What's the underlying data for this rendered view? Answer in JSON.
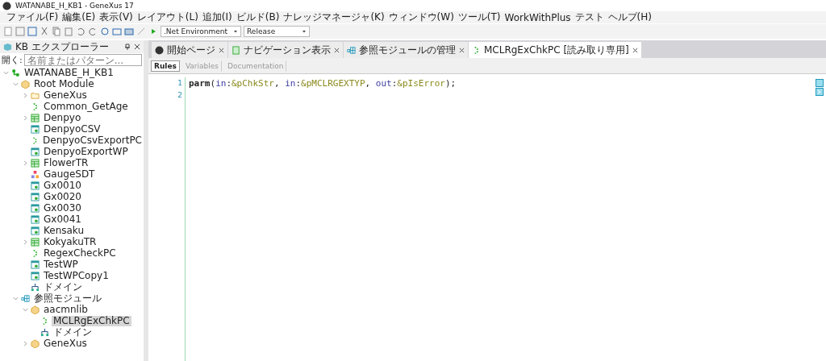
{
  "window": {
    "title": "WATANABE_H_KB1 - GeneXus 17"
  },
  "menu": [
    "ファイル(F)",
    "編集(E)",
    "表示(V)",
    "レイアウト(L)",
    "追加(I)",
    "ビルド(B)",
    "ナレッジマネージャ(K)",
    "ウィンドウ(W)",
    "ツール(T)",
    "WorkWithPlus",
    "テスト",
    "ヘルプ(H)"
  ],
  "toolbar": {
    "environment": ".Net Environment",
    "configuration": "Release"
  },
  "explorer": {
    "title": "KB エクスプローラー",
    "filter_label": "開く:",
    "filter_placeholder": "名前またはパターン...",
    "tree": [
      {
        "label": "WATANABE_H_KB1",
        "kind": "kb",
        "expanded": true,
        "selected": false,
        "children": [
          {
            "label": "Root Module",
            "kind": "module",
            "expanded": true,
            "selected": false,
            "children": [
              {
                "label": "GeneXus",
                "kind": "folder",
                "expanded": false,
                "selected": false
              },
              {
                "label": "Common_GetAge",
                "kind": "procedure",
                "selected": false
              },
              {
                "label": "Denpyo",
                "kind": "transaction",
                "expanded": false,
                "selected": false
              },
              {
                "label": "DenpyoCSV",
                "kind": "webpanel",
                "selected": false
              },
              {
                "label": "DenpyoCsvExportPC",
                "kind": "procedure",
                "selected": false
              },
              {
                "label": "DenpyoExportWP",
                "kind": "webpanel",
                "selected": false
              },
              {
                "label": "FlowerTR",
                "kind": "transaction",
                "expanded": false,
                "selected": false
              },
              {
                "label": "GaugeSDT",
                "kind": "sdt",
                "selected": false
              },
              {
                "label": "Gx0010",
                "kind": "webpanel",
                "selected": false
              },
              {
                "label": "Gx0020",
                "kind": "webpanel",
                "selected": false
              },
              {
                "label": "Gx0030",
                "kind": "webpanel",
                "selected": false
              },
              {
                "label": "Gx0041",
                "kind": "webpanel",
                "selected": false
              },
              {
                "label": "Kensaku",
                "kind": "webpanel",
                "selected": false
              },
              {
                "label": "KokyakuTR",
                "kind": "transaction",
                "expanded": false,
                "selected": false
              },
              {
                "label": "RegexCheckPC",
                "kind": "procedure",
                "selected": false
              },
              {
                "label": "TestWP",
                "kind": "webpanel",
                "selected": false
              },
              {
                "label": "TestWPCopy1",
                "kind": "webpanel",
                "selected": false
              },
              {
                "label": "ドメイン",
                "kind": "domain",
                "selected": false
              }
            ]
          },
          {
            "label": "参照モジュール",
            "kind": "references",
            "expanded": true,
            "selected": false,
            "children": [
              {
                "label": "aacmnlib",
                "kind": "module",
                "expanded": true,
                "selected": false,
                "children": [
                  {
                    "label": "MCLRgExChkPC",
                    "kind": "procedure",
                    "selected": true
                  },
                  {
                    "label": "ドメイン",
                    "kind": "domain",
                    "selected": false
                  }
                ]
              },
              {
                "label": "GeneXus",
                "kind": "module",
                "expanded": false,
                "selected": false
              }
            ]
          }
        ]
      }
    ]
  },
  "tabs": [
    {
      "label": "開始ページ",
      "kind": "start",
      "selected": false
    },
    {
      "label": "ナビゲーション表示",
      "kind": "navigation",
      "selected": false
    },
    {
      "label": "参照モジュールの管理",
      "kind": "references",
      "selected": false
    },
    {
      "label": "MCLRgExChkPC [読み取り専用]",
      "kind": "procedure",
      "selected": true
    }
  ],
  "subtabs": [
    {
      "label": "Rules",
      "selected": true
    },
    {
      "label": "Variables",
      "selected": false
    },
    {
      "label": "Documentation",
      "selected": false
    }
  ],
  "editor": {
    "lines": [
      {
        "number": "1",
        "tokens": [
          {
            "text": "parm",
            "kind": "keyword"
          },
          {
            "text": "(",
            "kind": "punct"
          },
          {
            "text": "in",
            "kind": "modifier"
          },
          {
            "text": ":",
            "kind": "punct"
          },
          {
            "text": "&pChkStr",
            "kind": "variable"
          },
          {
            "text": ", ",
            "kind": "punct"
          },
          {
            "text": "in",
            "kind": "modifier"
          },
          {
            "text": ":",
            "kind": "punct"
          },
          {
            "text": "&pMCLRGEXTYP",
            "kind": "variable"
          },
          {
            "text": ", ",
            "kind": "punct"
          },
          {
            "text": "out",
            "kind": "modifier"
          },
          {
            "text": ":",
            "kind": "punct"
          },
          {
            "text": "&pIsError",
            "kind": "variable"
          },
          {
            "text": ");",
            "kind": "punct"
          }
        ]
      },
      {
        "number": "2"
      }
    ]
  }
}
